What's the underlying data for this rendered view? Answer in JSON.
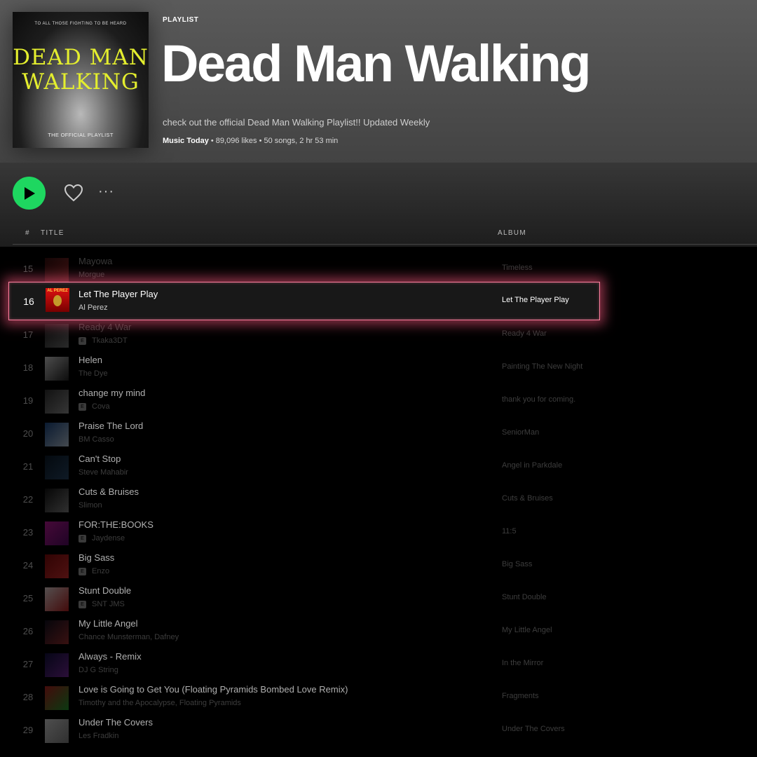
{
  "header": {
    "cover": {
      "tagline": "TO ALL THOSE FIGHTING TO BE HEARD",
      "big_title": "DEAD MAN WALKING",
      "subtitle": "THE OFFICIAL PLAYLIST"
    },
    "kicker": "PLAYLIST",
    "title": "Dead Man Walking",
    "description": "check out the official Dead Man Walking Playlist!! Updated Weekly",
    "owner": "Music Today",
    "likes": "89,096 likes",
    "songs": "50 songs,",
    "duration": "2 hr 53 min"
  },
  "controls": {
    "play_icon": "play-icon",
    "like_icon": "heart-icon",
    "more_icon": "more-icon"
  },
  "columns": {
    "number": "#",
    "title": "TITLE",
    "album": "ALBUM"
  },
  "highlight": {
    "number": "16",
    "title": "Let The Player Play",
    "artist": "Al Perez",
    "album": "Let The Player Play",
    "art_text": "AL PEREZ",
    "glow_color": "#ff5a82"
  },
  "tracks": [
    {
      "number": "15",
      "title": "Mayowa",
      "artist": "Morgue",
      "album": "Timeless",
      "explicit": false,
      "art": [
        "#3a1010",
        "#a23030"
      ]
    },
    {
      "number": "17",
      "title": "Ready 4 War",
      "artist": "Tkaka3DT",
      "album": "Ready 4 War",
      "explicit": true,
      "art": [
        "#222",
        "#777"
      ]
    },
    {
      "number": "18",
      "title": "Helen",
      "artist": "The Dye",
      "album": "Painting The New Night",
      "explicit": false,
      "art": [
        "#ddd",
        "#222"
      ]
    },
    {
      "number": "19",
      "title": "change my mind",
      "artist": "Cova",
      "album": "thank you for coming.",
      "explicit": true,
      "art": [
        "#333",
        "#999"
      ]
    },
    {
      "number": "20",
      "title": "Praise The Lord",
      "artist": "BM Casso",
      "album": "SeniorMan",
      "explicit": false,
      "art": [
        "#1b4a8a",
        "#c0d0e0"
      ]
    },
    {
      "number": "21",
      "title": "Can't Stop",
      "artist": "Steve Mahabir",
      "album": "Angel in Parkdale",
      "explicit": false,
      "art": [
        "#0b1a2a",
        "#2a4a6a"
      ]
    },
    {
      "number": "22",
      "title": "Cuts & Bruises",
      "artist": "Slimon",
      "album": "Cuts & Bruises",
      "explicit": false,
      "art": [
        "#111",
        "#888"
      ]
    },
    {
      "number": "23",
      "title": "FOR:THE:BOOKS",
      "artist": "Jaydense",
      "album": "11:5",
      "explicit": true,
      "art": [
        "#c71aa0",
        "#5a0a6a"
      ]
    },
    {
      "number": "24",
      "title": "Big Sass",
      "artist": "Enzo",
      "album": "Big Sass",
      "explicit": true,
      "art": [
        "#8a0a0a",
        "#e03030"
      ]
    },
    {
      "number": "25",
      "title": "Stunt Double",
      "artist": "SNT JMS",
      "album": "Stunt Double",
      "explicit": true,
      "art": [
        "#f0e0e0",
        "#c02020"
      ]
    },
    {
      "number": "26",
      "title": "My Little Angel",
      "artist": "Chance Munsterman, Dafney",
      "album": "My Little Angel",
      "explicit": false,
      "art": [
        "#101020",
        "#a03030"
      ]
    },
    {
      "number": "27",
      "title": "Always - Remix",
      "artist": "DJ G String",
      "album": "In the Mirror",
      "explicit": false,
      "art": [
        "#101040",
        "#7a2aa0"
      ]
    },
    {
      "number": "28",
      "title": "Love is Going to Get You (Floating Pyramids Bombed Love Remix)",
      "artist": "Timothy and the Apocalypse, Floating Pyramids",
      "album": "Fragments",
      "explicit": false,
      "art": [
        "#c02020",
        "#20a030"
      ]
    },
    {
      "number": "29",
      "title": "Under The Covers",
      "artist": "Les Fradkin",
      "album": "Under The Covers",
      "explicit": false,
      "art": [
        "#e0e0e0",
        "#888"
      ]
    }
  ]
}
